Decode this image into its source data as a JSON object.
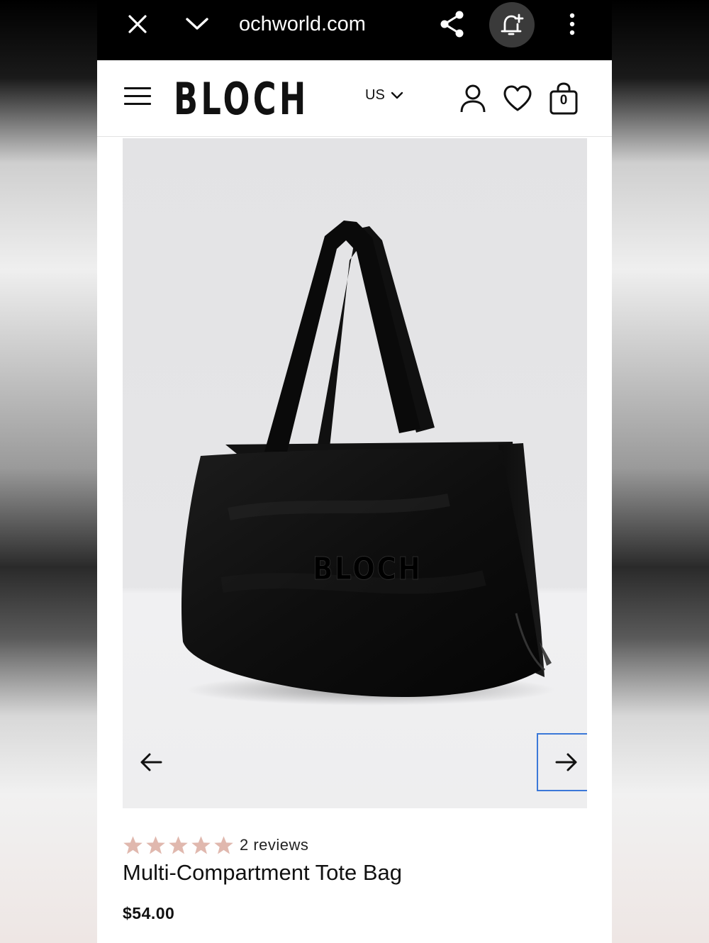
{
  "browser": {
    "url": "ochworld.com",
    "icons": [
      "close-icon",
      "chevron-down-icon",
      "share-icon",
      "bell-plus-icon",
      "more-vert-icon"
    ]
  },
  "header": {
    "logo": "BLOCH",
    "region": "US",
    "cart_count": "0",
    "icons": [
      "menu-icon",
      "account-icon",
      "heart-icon",
      "shopping-bag-icon"
    ]
  },
  "gallery": {
    "image_logo_text": "BLOCH",
    "prev_icon": "arrow-left-icon",
    "next_icon": "arrow-right-icon",
    "focus_color": "#3b78d8"
  },
  "product": {
    "rating": 5,
    "rating_max": 5,
    "star_color": "#e0b8ae",
    "reviews": "2 reviews",
    "title": "Multi-Compartment Tote Bag",
    "price": "$54.00"
  }
}
